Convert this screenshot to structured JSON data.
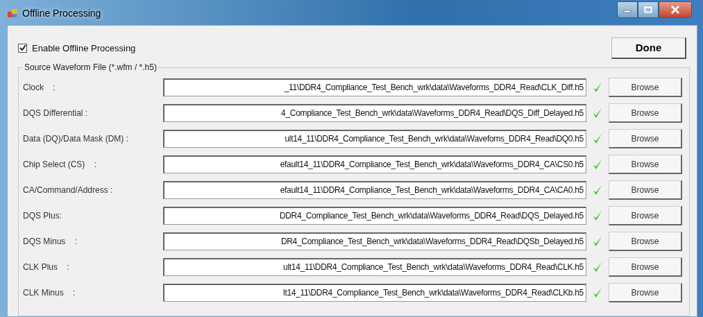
{
  "window": {
    "title": "Offline Processing"
  },
  "enable_checkbox": {
    "label": "Enable Offline Processing",
    "checked": true
  },
  "done_button": "Done",
  "group": {
    "title": "Source Waveform File (*.wfm / *.h5)",
    "rows": [
      {
        "label": "Clock    :",
        "value": "_11\\DDR4_Compliance_Test_Bench_wrk\\data\\Waveforms_DDR4_Read\\CLK_Diff.h5",
        "valid": true,
        "button": "Browse"
      },
      {
        "label": "DQS Differential :",
        "value": "4_Compliance_Test_Bench_wrk\\data\\Waveforms_DDR4_Read\\DQS_Diff_Delayed.h5",
        "valid": true,
        "button": "Browse"
      },
      {
        "label": "Data (DQ)/Data Mask (DM) :",
        "value": "ult14_11\\DDR4_Compliance_Test_Bench_wrk\\data\\Wavefoms_DDR4_Read\\DQ0.h5",
        "valid": true,
        "button": "Browse"
      },
      {
        "label": "Chip Select (CS)    :",
        "value": "efault14_11\\DDR4_Compliance_Test_Bench_wrk\\data\\Waveforms_DDR4_CA\\CS0.h5",
        "valid": true,
        "button": "Browse"
      },
      {
        "label": "CA/Command/Address :",
        "value": "efault14_11\\DDR4_Compliance_Test_Bench_wrk\\data\\Waveforms_DDR4_CA\\CA0.h5",
        "valid": true,
        "button": "Browse"
      },
      {
        "label": "DQS Plus:",
        "value": "DDR4_Compliance_Test_Bench_wrk\\data\\Waveforms_DDR4_Read\\DQS_Delayed.h5",
        "valid": true,
        "button": "Browse"
      },
      {
        "label": "DQS Minus    :",
        "value": "DR4_Compliance_Test_Bench_wrk\\data\\Waveforms_DDR4_Read\\DQSb_Delayed.h5",
        "valid": true,
        "button": "Browse"
      },
      {
        "label": "CLK Plus    :",
        "value": "ult14_11\\DDR4_Compliance_Test_Bench_wrk\\data\\Waveforms_DDR4_Read\\CLK.h5",
        "valid": true,
        "button": "Browse"
      },
      {
        "label": "CLK Minus    :",
        "value": "lt14_11\\DDR4_Compliance_Test_Bench_wrk\\data\\Waveforms_DDR4_Read\\CLKb.h5",
        "valid": true,
        "button": "Browse"
      }
    ]
  }
}
